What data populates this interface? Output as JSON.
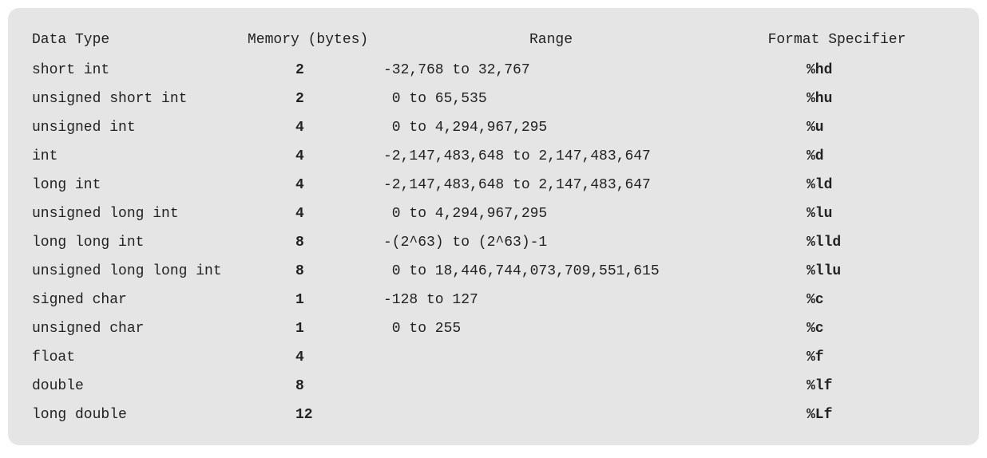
{
  "table": {
    "headers": {
      "data_type": "Data Type",
      "memory": "Memory (bytes)",
      "range": "Range",
      "format_specifier": "Format Specifier"
    },
    "rows": [
      {
        "data_type": "short int",
        "memory": "2",
        "range": "-32,768 to 32,767",
        "format_specifier": "%hd"
      },
      {
        "data_type": "unsigned short int",
        "memory": "2",
        "range": " 0 to 65,535",
        "format_specifier": "%hu"
      },
      {
        "data_type": "unsigned int",
        "memory": "4",
        "range": " 0 to 4,294,967,295",
        "format_specifier": "%u"
      },
      {
        "data_type": "int",
        "memory": "4",
        "range": "-2,147,483,648 to 2,147,483,647",
        "format_specifier": "%d"
      },
      {
        "data_type": "long int",
        "memory": "4",
        "range": "-2,147,483,648 to 2,147,483,647",
        "format_specifier": "%ld"
      },
      {
        "data_type": "unsigned long int",
        "memory": "4",
        "range": " 0 to 4,294,967,295",
        "format_specifier": "%lu"
      },
      {
        "data_type": "long long int",
        "memory": "8",
        "range": "-(2^63) to (2^63)-1",
        "format_specifier": "%lld"
      },
      {
        "data_type": "unsigned long long int",
        "memory": "8",
        "range": " 0 to 18,446,744,073,709,551,615",
        "format_specifier": "%llu"
      },
      {
        "data_type": "signed char",
        "memory": "1",
        "range": "-128 to 127",
        "format_specifier": "%c"
      },
      {
        "data_type": "unsigned char",
        "memory": "1",
        "range": " 0 to 255",
        "format_specifier": "%c"
      },
      {
        "data_type": "float",
        "memory": "4",
        "range": "",
        "format_specifier": "%f"
      },
      {
        "data_type": "double",
        "memory": "8",
        "range": "",
        "format_specifier": "%lf"
      },
      {
        "data_type": "long double",
        "memory": "12",
        "range": "",
        "format_specifier": "%Lf"
      }
    ]
  }
}
